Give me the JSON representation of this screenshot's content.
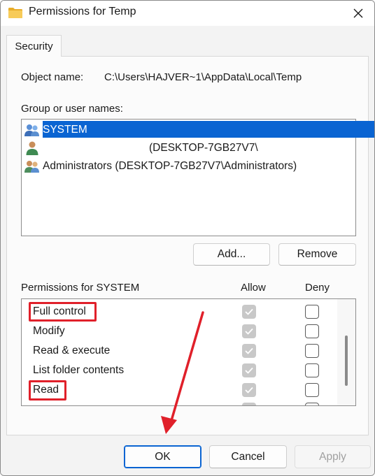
{
  "window": {
    "title": "Permissions for Temp",
    "close_label": "✕"
  },
  "tab": {
    "label": "Security"
  },
  "object": {
    "label": "Object name:",
    "value": "C:\\Users\\HAJVER~1\\AppData\\Local\\Temp"
  },
  "users": {
    "label": "Group or user names:",
    "items": [
      {
        "name": "SYSTEM"
      },
      {
        "name": "(DESKTOP-7GB27V7\\"
      },
      {
        "name": "Administrators (DESKTOP-7GB27V7\\Administrators)"
      }
    ]
  },
  "buttons": {
    "add": "Add...",
    "remove": "Remove",
    "ok": "OK",
    "cancel": "Cancel",
    "apply": "Apply"
  },
  "permissions": {
    "label": "Permissions for SYSTEM",
    "allow_header": "Allow",
    "deny_header": "Deny",
    "items": [
      {
        "name": "Full control",
        "allow": true,
        "deny": false
      },
      {
        "name": "Modify",
        "allow": true,
        "deny": false
      },
      {
        "name": "Read & execute",
        "allow": true,
        "deny": false
      },
      {
        "name": "List folder contents",
        "allow": true,
        "deny": false
      },
      {
        "name": "Read",
        "allow": true,
        "deny": false
      },
      {
        "name": "",
        "allow": true,
        "deny": false
      }
    ]
  },
  "colors": {
    "accent": "#0a64d2",
    "annotation": "#e0202a",
    "folder": "#f2c14e"
  },
  "icons": {
    "folder": "folder-icon",
    "close": "close-icon",
    "group_user": "users-group-icon",
    "single_user": "user-icon",
    "admins": "admins-group-icon"
  }
}
